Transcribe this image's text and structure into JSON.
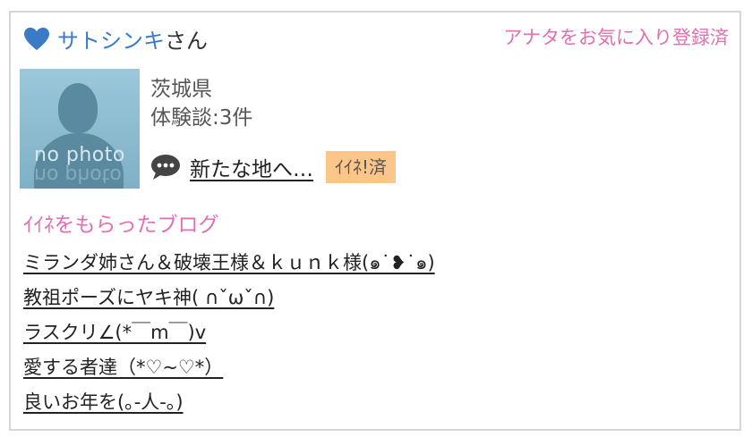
{
  "profile": {
    "username": "サトシンキ",
    "honorific": "さん",
    "favorite_status": "アナタをお気に入り登録済",
    "avatar_text": "no photo",
    "prefecture": "茨城県",
    "experience_count": "体験談:3件",
    "latest_post": "新たな地へ…",
    "iine_badge": "ｲｲﾈ!済"
  },
  "colors": {
    "name_blue": "#3a7bc8",
    "accent_pink": "#e070b0",
    "badge_orange": "#fcc68a"
  },
  "liked_blogs": {
    "title": "ｲｲﾈをもらったブログ",
    "items": [
      "ミランダ姉さん＆破壊王様＆ｋｕｎｋ様(๑˙❥˙๑)",
      "教祖ポーズにヤキ神( ∩ˇωˇ∩)",
      "ラスクリ∠(*￣m￣)v",
      "愛する者達（*♡~♡*）",
      "良いお年を(｡-人-｡)"
    ]
  }
}
